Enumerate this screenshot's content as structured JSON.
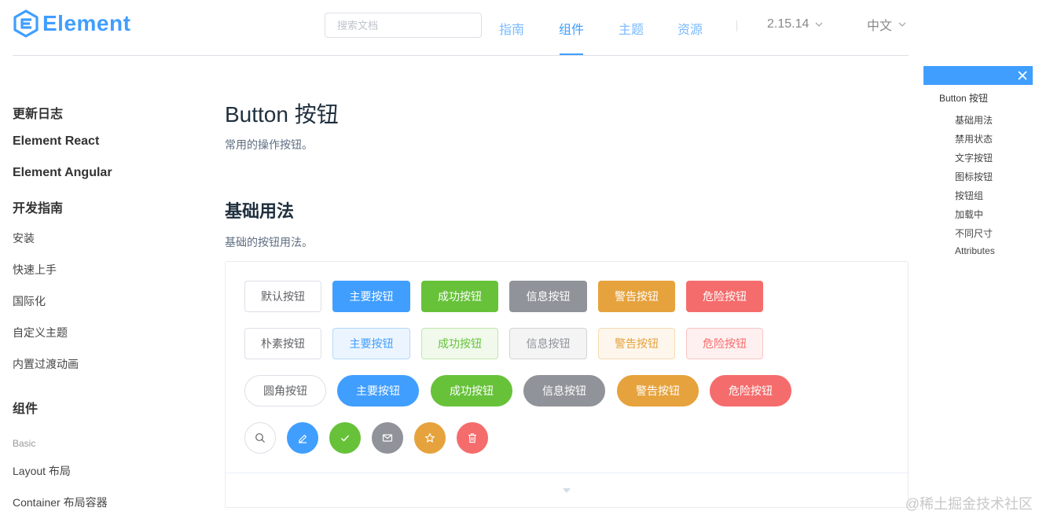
{
  "header": {
    "logo_text": "Element",
    "search_placeholder": "搜索文档",
    "nav": [
      "指南",
      "组件",
      "主题",
      "资源"
    ],
    "version": "2.15.14",
    "language": "中文"
  },
  "sidebar": {
    "headings": [
      "更新日志",
      "Element React",
      "Element Angular",
      "开发指南"
    ],
    "guide_links": [
      "安装",
      "快速上手",
      "国际化",
      "自定义主题",
      "内置过渡动画"
    ],
    "components_heading": "组件",
    "group_label": "Basic",
    "component_links": [
      "Layout 布局",
      "Container 布局容器"
    ]
  },
  "main": {
    "title": "Button 按钮",
    "description": "常用的操作按钮。",
    "section_title": "基础用法",
    "section_description": "基础的按钮用法。",
    "row1": [
      "默认按钮",
      "主要按钮",
      "成功按钮",
      "信息按钮",
      "警告按钮",
      "危险按钮"
    ],
    "row2": [
      "朴素按钮",
      "主要按钮",
      "成功按钮",
      "信息按钮",
      "警告按钮",
      "危险按钮"
    ],
    "row3": [
      "圆角按钮",
      "主要按钮",
      "成功按钮",
      "信息按钮",
      "警告按钮",
      "危险按钮"
    ],
    "icon_buttons": [
      "search-icon",
      "edit-icon",
      "check-icon",
      "message-icon",
      "star-icon",
      "delete-icon"
    ]
  },
  "toc": {
    "title": "Button 按钮",
    "items": [
      "基础用法",
      "禁用状态",
      "文字按钮",
      "图标按钮",
      "按钮组",
      "加载中",
      "不同尺寸",
      "Attributes"
    ]
  },
  "colors": {
    "primary": "#409eff",
    "success": "#67c23a",
    "info": "#909399",
    "warning": "#e6a23c",
    "danger": "#f56c6c"
  },
  "watermark": "@稀土掘金技术社区"
}
